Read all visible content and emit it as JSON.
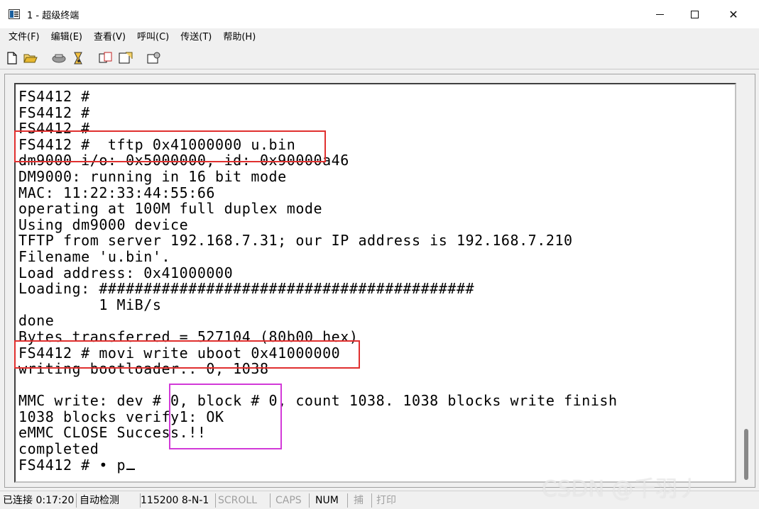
{
  "window": {
    "title": "1 - 超级终端",
    "minimize_glyph": "—",
    "close_glyph": "✕"
  },
  "menu": [
    "文件(F)",
    "编辑(E)",
    "查看(V)",
    "呼叫(C)",
    "传送(T)",
    "帮助(H)"
  ],
  "toolbar": {
    "icons": [
      "new-file-icon",
      "open-folder-icon",
      "disconnect-icon",
      "receive-icon",
      "copy-icon",
      "properties-icon",
      "settings-icon"
    ]
  },
  "terminal": {
    "lines": [
      "FS4412 #",
      "FS4412 #",
      "FS4412 #",
      "FS4412 #  tftp 0x41000000 u.bin",
      "dm9000 i/o: 0x5000000, id: 0x90000a46",
      "DM9000: running in 16 bit mode",
      "MAC: 11:22:33:44:55:66",
      "operating at 100M full duplex mode",
      "Using dm9000 device",
      "TFTP from server 192.168.7.31; our IP address is 192.168.7.210",
      "Filename 'u.bin'.",
      "Load address: 0x41000000",
      "Loading: ##########################################",
      "         1 MiB/s",
      "done",
      "Bytes transferred = 527104 (80b00 hex)",
      "FS4412 # movi write uboot 0x41000000",
      "writing bootloader.. 0, 1038",
      "",
      "MMC write: dev # 0, block # 0, count 1038. 1038 blocks write finish",
      "1038 blocks verify1: OK",
      "eMMC CLOSE Success.!!",
      "completed"
    ],
    "prompt_line": "FS4412 # • p"
  },
  "status": {
    "connection": "已连接 0:17:20",
    "detect": "自动检测",
    "baud": "115200 8-N-1",
    "scroll": "SCROLL",
    "caps": "CAPS",
    "num": "NUM",
    "capture": "捕",
    "print": "打印"
  },
  "watermark": "CSDN @千羽丿",
  "colors": {
    "highlight_red": "#e0302f",
    "highlight_pink": "#d23ad8",
    "terminal_bg": "#ffffff",
    "chrome_bg": "#f0f0f0"
  }
}
